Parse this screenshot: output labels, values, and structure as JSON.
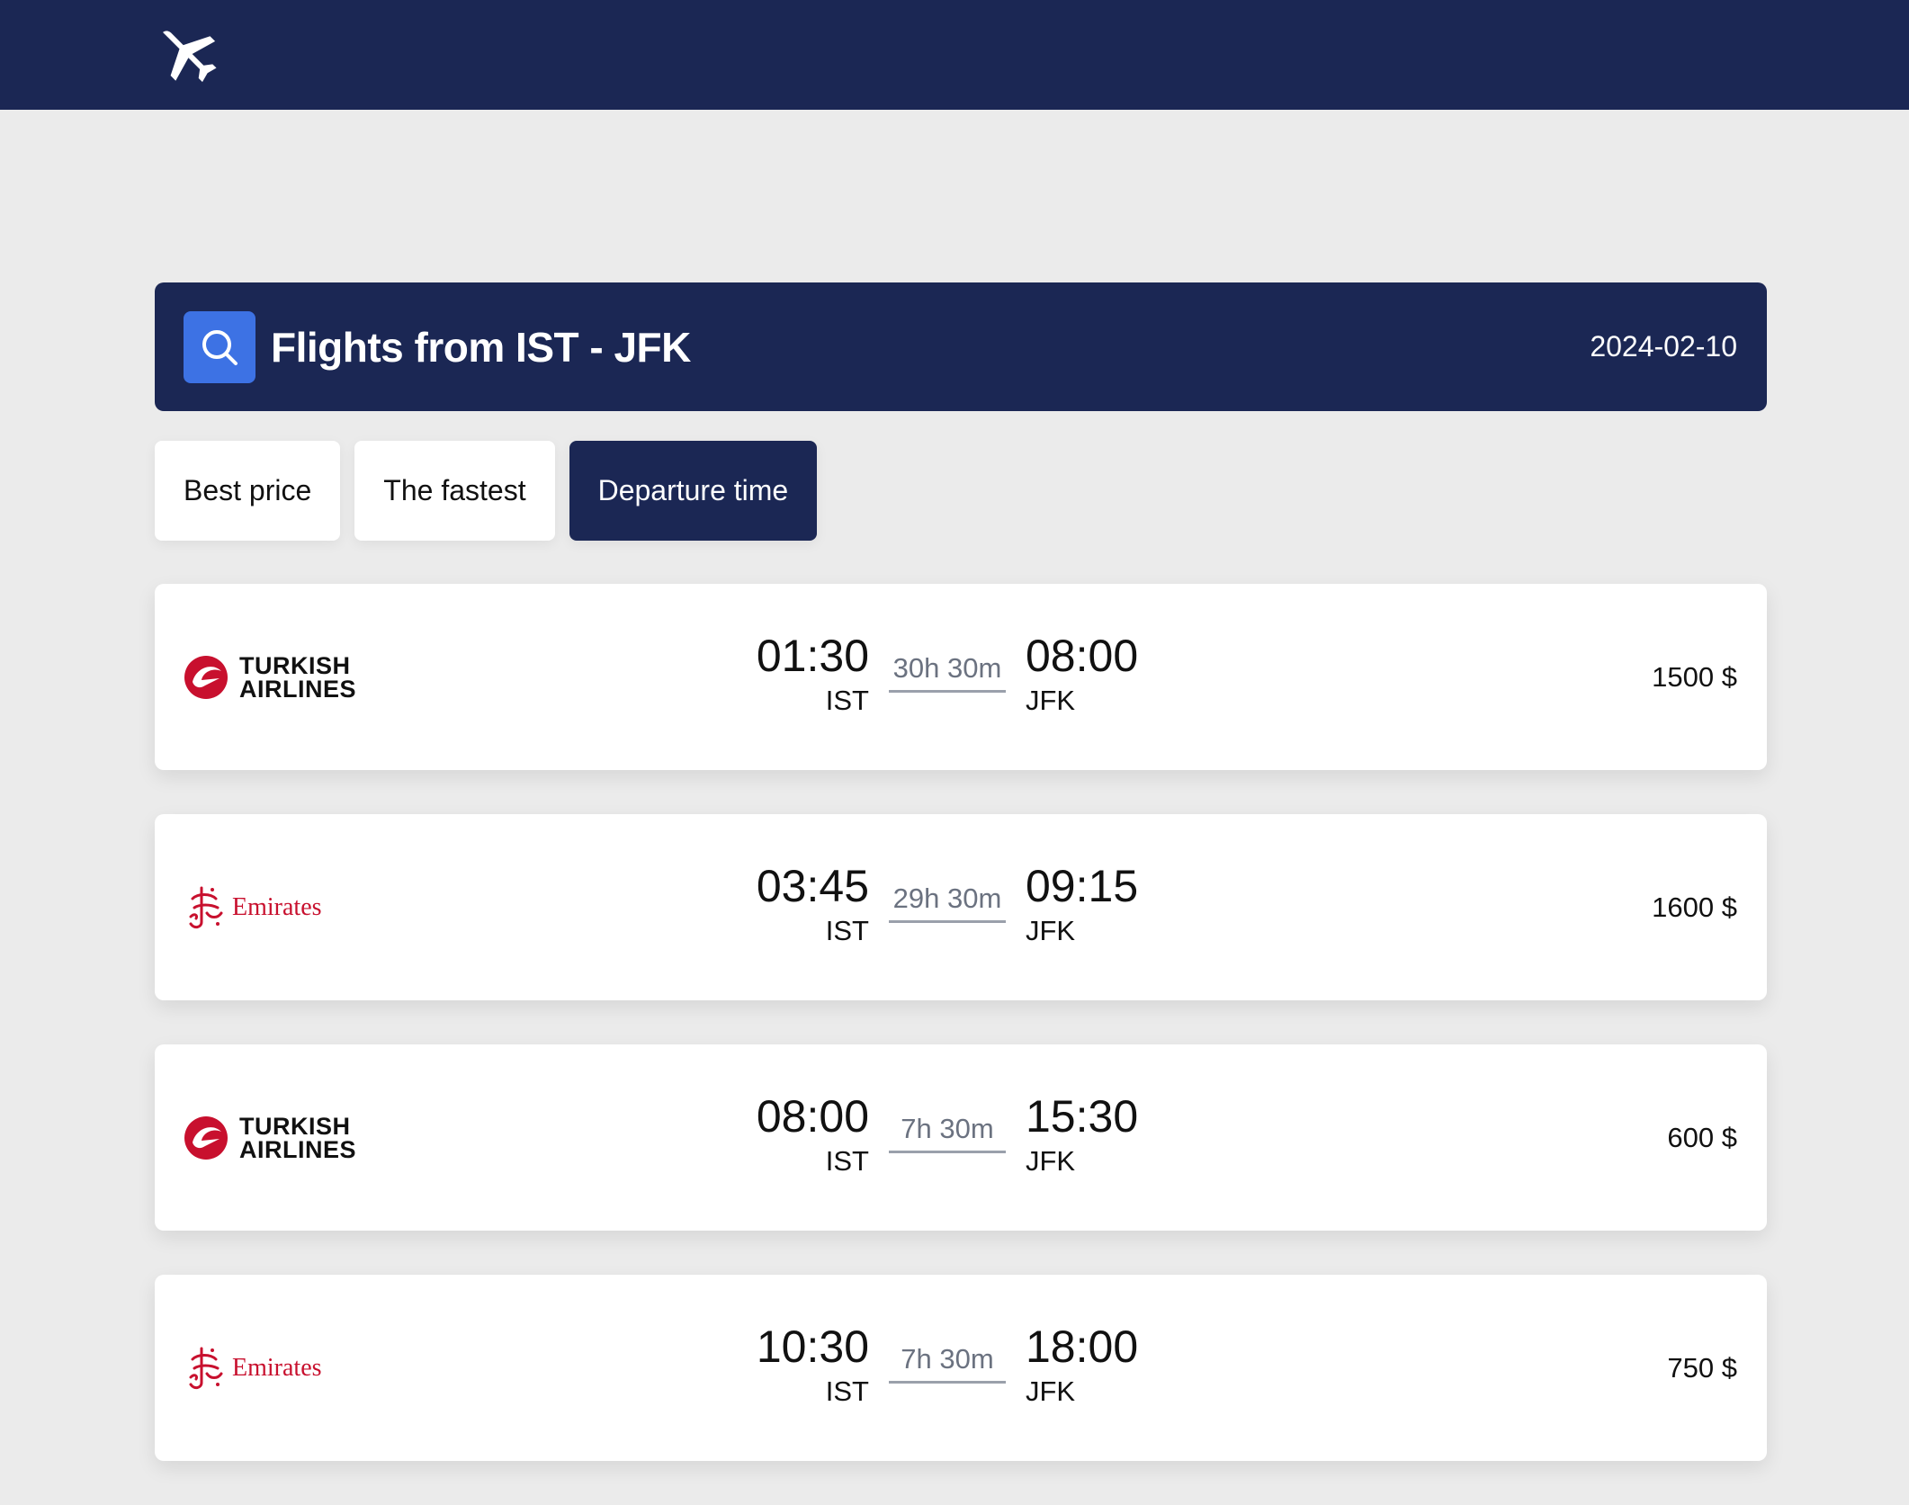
{
  "header": {
    "logo_icon": "airplane-icon"
  },
  "search": {
    "icon": "search-icon",
    "title": "Flights from IST - JFK",
    "date": "2024-02-10"
  },
  "sort_tabs": [
    {
      "label": "Best price",
      "active": false
    },
    {
      "label": "The fastest",
      "active": false
    },
    {
      "label": "Departure time",
      "active": true
    }
  ],
  "flights": [
    {
      "airline": "turkish",
      "logo_text_1": "TURKISH",
      "logo_text_2": "AIRLINES",
      "dep_time": "01:30",
      "dep_airport": "IST",
      "duration": "30h 30m",
      "arr_time": "08:00",
      "arr_airport": "JFK",
      "price": "1500 $"
    },
    {
      "airline": "emirates",
      "logo_text": "Emirates",
      "dep_time": "03:45",
      "dep_airport": "IST",
      "duration": "29h 30m",
      "arr_time": "09:15",
      "arr_airport": "JFK",
      "price": "1600 $"
    },
    {
      "airline": "turkish",
      "logo_text_1": "TURKISH",
      "logo_text_2": "AIRLINES",
      "dep_time": "08:00",
      "dep_airport": "IST",
      "duration": "7h 30m",
      "arr_time": "15:30",
      "arr_airport": "JFK",
      "price": "600 $"
    },
    {
      "airline": "emirates",
      "logo_text": "Emirates",
      "dep_time": "10:30",
      "dep_airport": "IST",
      "duration": "7h 30m",
      "arr_time": "18:00",
      "arr_airport": "JFK",
      "price": "750 $"
    }
  ],
  "colors": {
    "navy": "#1b2754",
    "accent_blue": "#3d72e4",
    "background": "#ebebeb",
    "turkish_red": "#c8102e",
    "emirates_red": "#c8102e"
  }
}
